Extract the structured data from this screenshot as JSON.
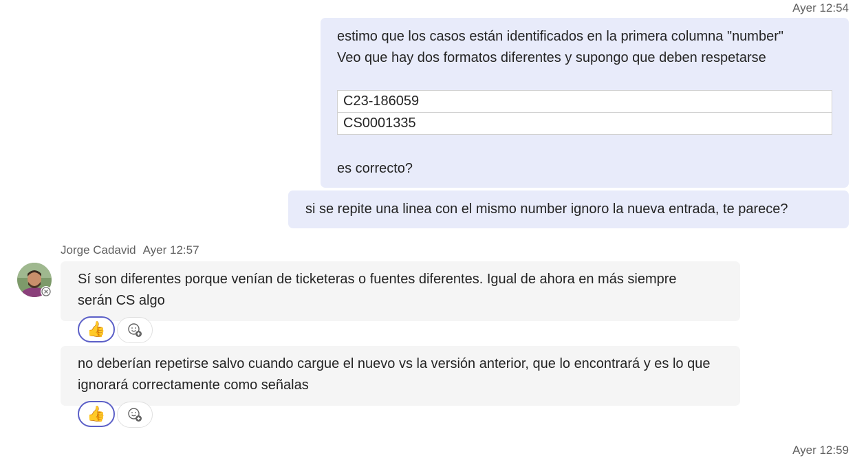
{
  "outgoing_top": {
    "timestamp": "Ayer 12:54",
    "message1": {
      "line1": "estimo que los casos están identificados en la primera columna \"number\"",
      "line2": "Veo que hay dos formatos diferentes y supongo que deben respetarse",
      "table_rows": [
        "C23-186059",
        "CS0001335"
      ],
      "closing": "es correcto?"
    },
    "message2": "si se repite una linea con el mismo number ignoro la nueva entrada, te parece?"
  },
  "incoming": {
    "sender_name": "Jorge Cadavid",
    "timestamp": "Ayer 12:57",
    "message1": {
      "text": "Sí son diferentes porque venían de ticketeras o fuentes diferentes. Igual de ahora en más siempre serán CS algo",
      "reaction": "👍"
    },
    "message2": {
      "text": "no deberían repetirse salvo cuando cargue el nuevo vs la versión anterior, que lo encontrará y es lo que ignorará correctamente como señalas",
      "reaction": "👍"
    }
  },
  "outgoing_bottom": {
    "timestamp": "Ayer 12:59"
  },
  "icons": {
    "avatar": "avatar-photo",
    "status": "presence-offline-icon",
    "add_reaction": "add-reaction-icon",
    "thumbs_up": "thumbs-up-icon"
  },
  "colors": {
    "outgoing_bubble": "#e8ebfa",
    "incoming_bubble": "#f5f5f5",
    "reaction_border": "#5b5fc7"
  }
}
